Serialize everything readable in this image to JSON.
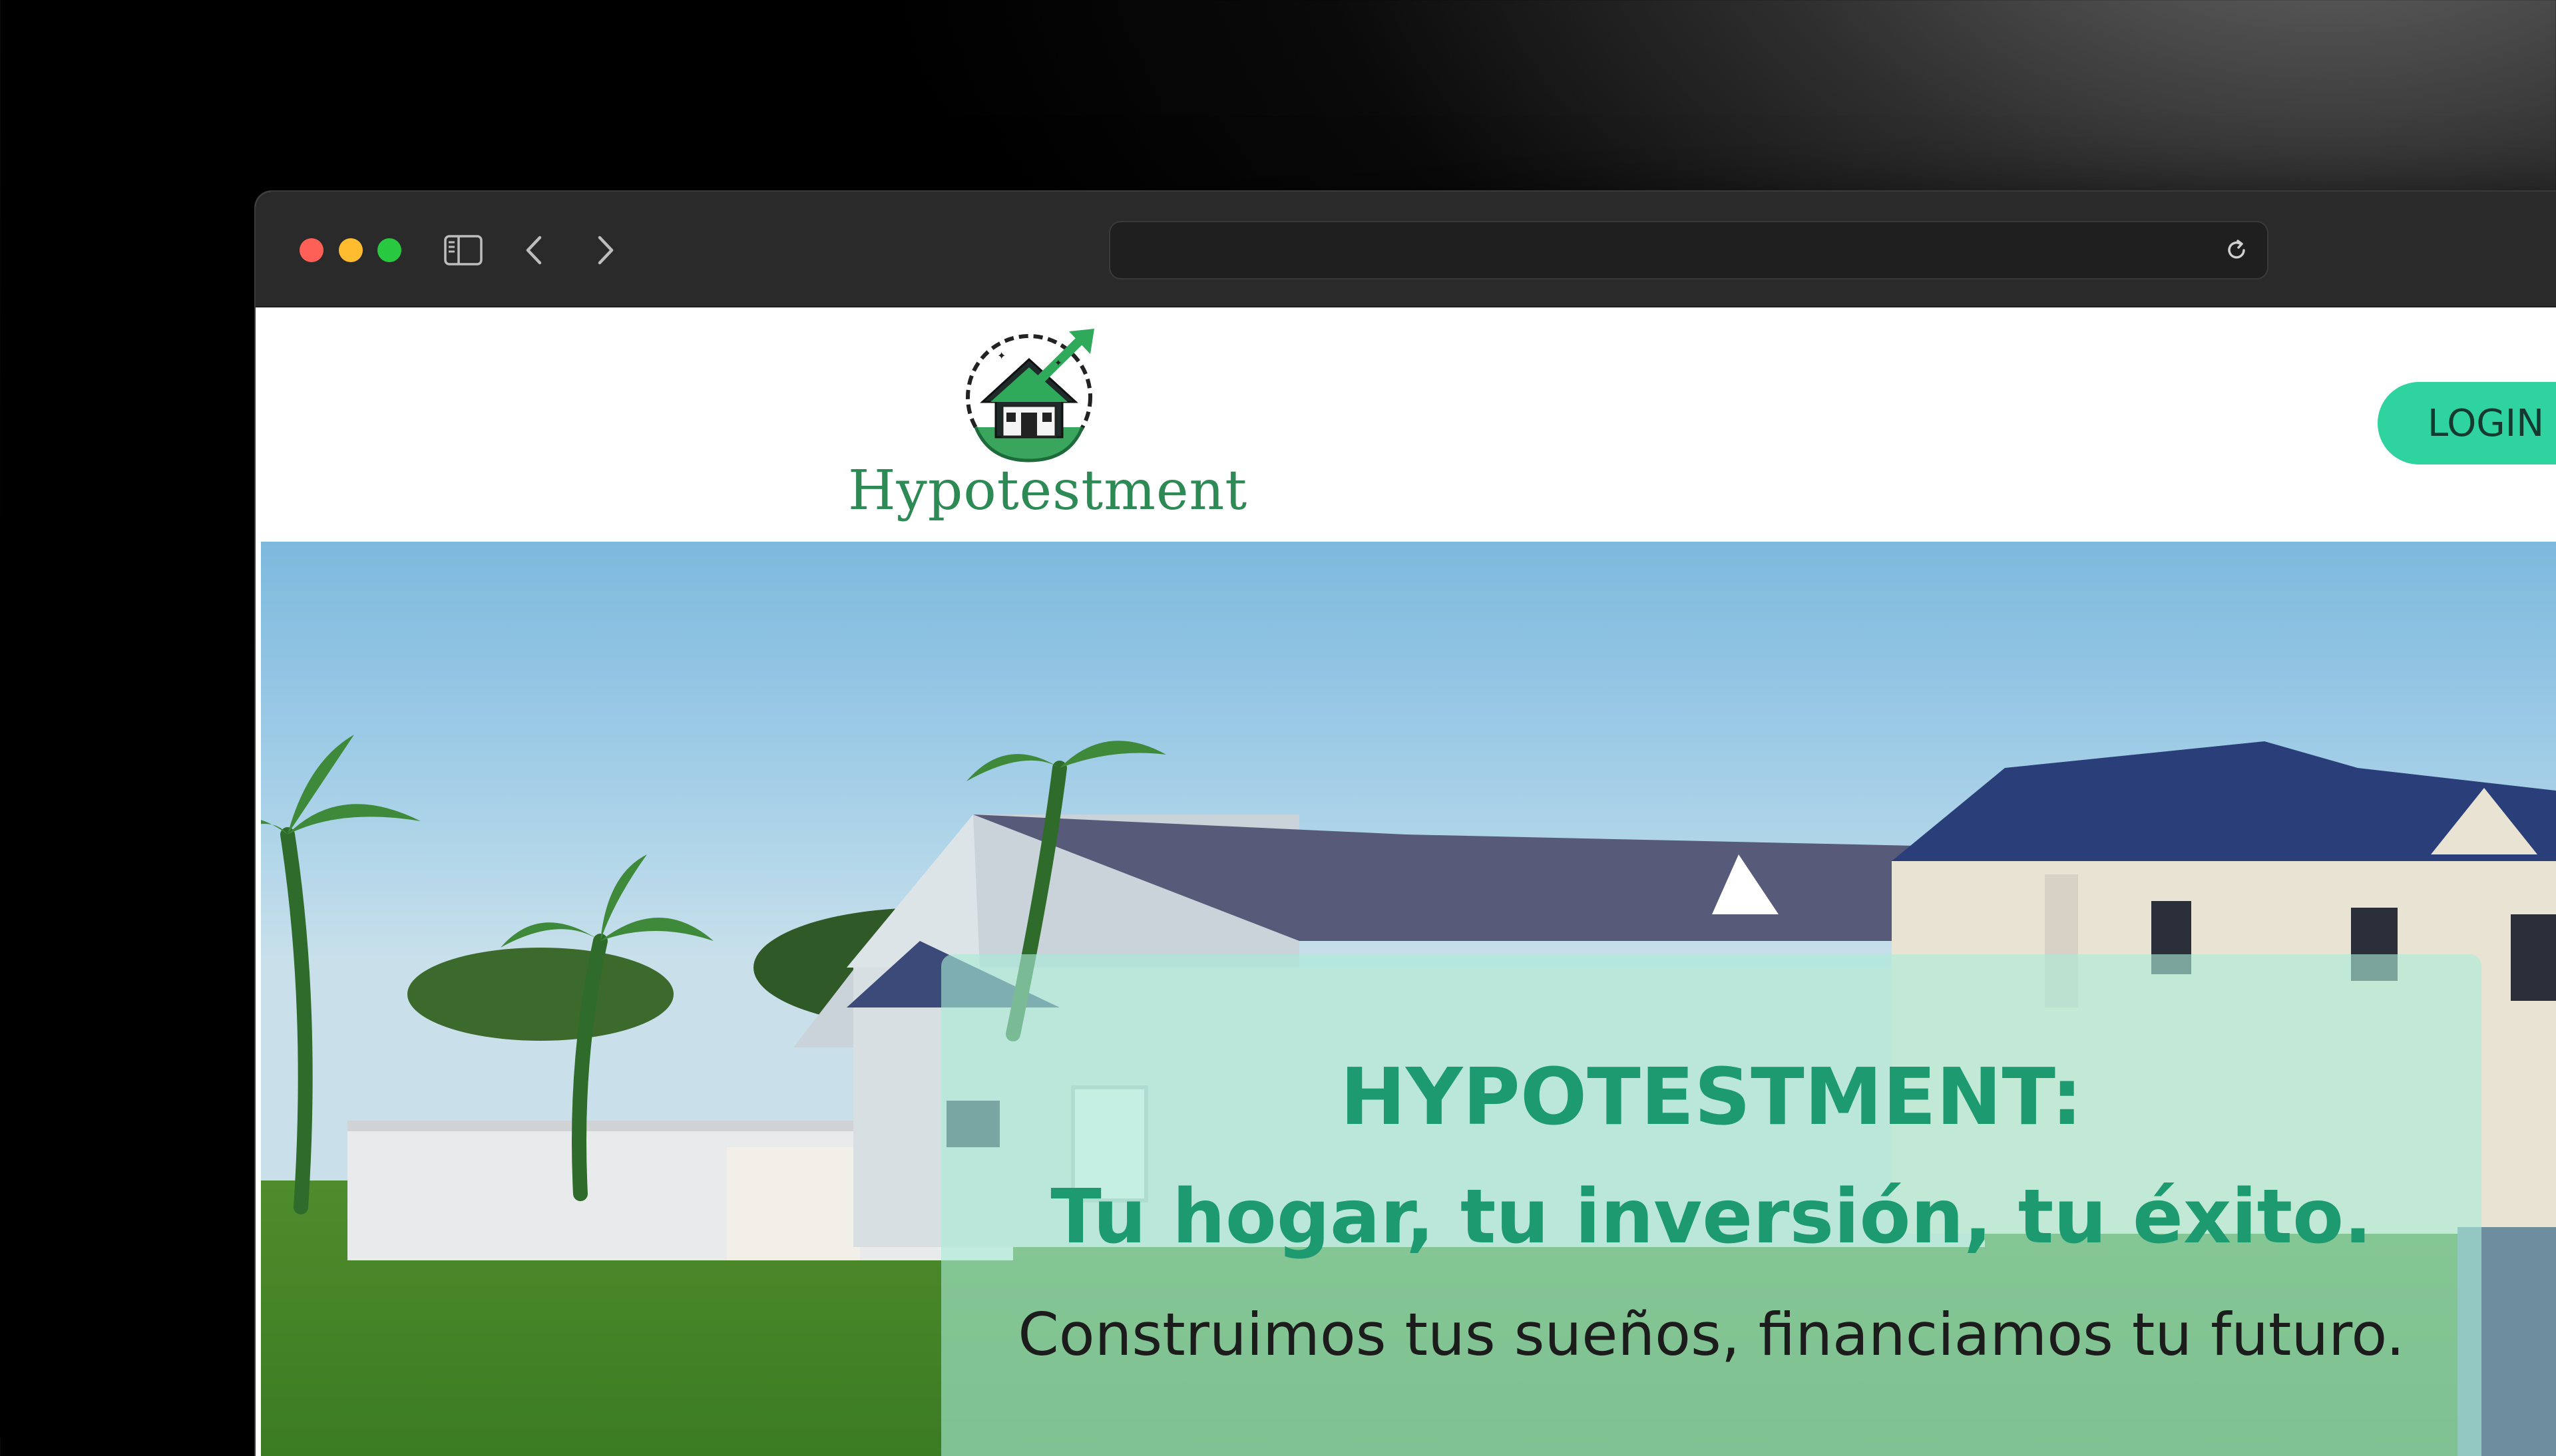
{
  "browser": {
    "url": "",
    "controls": {
      "close": "close-window",
      "minimize": "minimize-window",
      "zoom": "zoom-window",
      "sidebar": "sidebar-toggle-icon",
      "back": "chevron-left-icon",
      "forward": "chevron-right-icon",
      "reload": "reload-icon"
    }
  },
  "header": {
    "logo_text": "Hypotestment",
    "login_label": "LOGIN"
  },
  "hero": {
    "title": "HYPOTESTMENT:",
    "tagline": "Tu hogar, tu inversión, tu éxito.",
    "subtitle": "Construimos tus sueños, financiamos tu futuro."
  },
  "colors": {
    "brand_green": "#2d8a55",
    "accent": "#2ed3a0",
    "hero_text": "#1e9a70"
  }
}
